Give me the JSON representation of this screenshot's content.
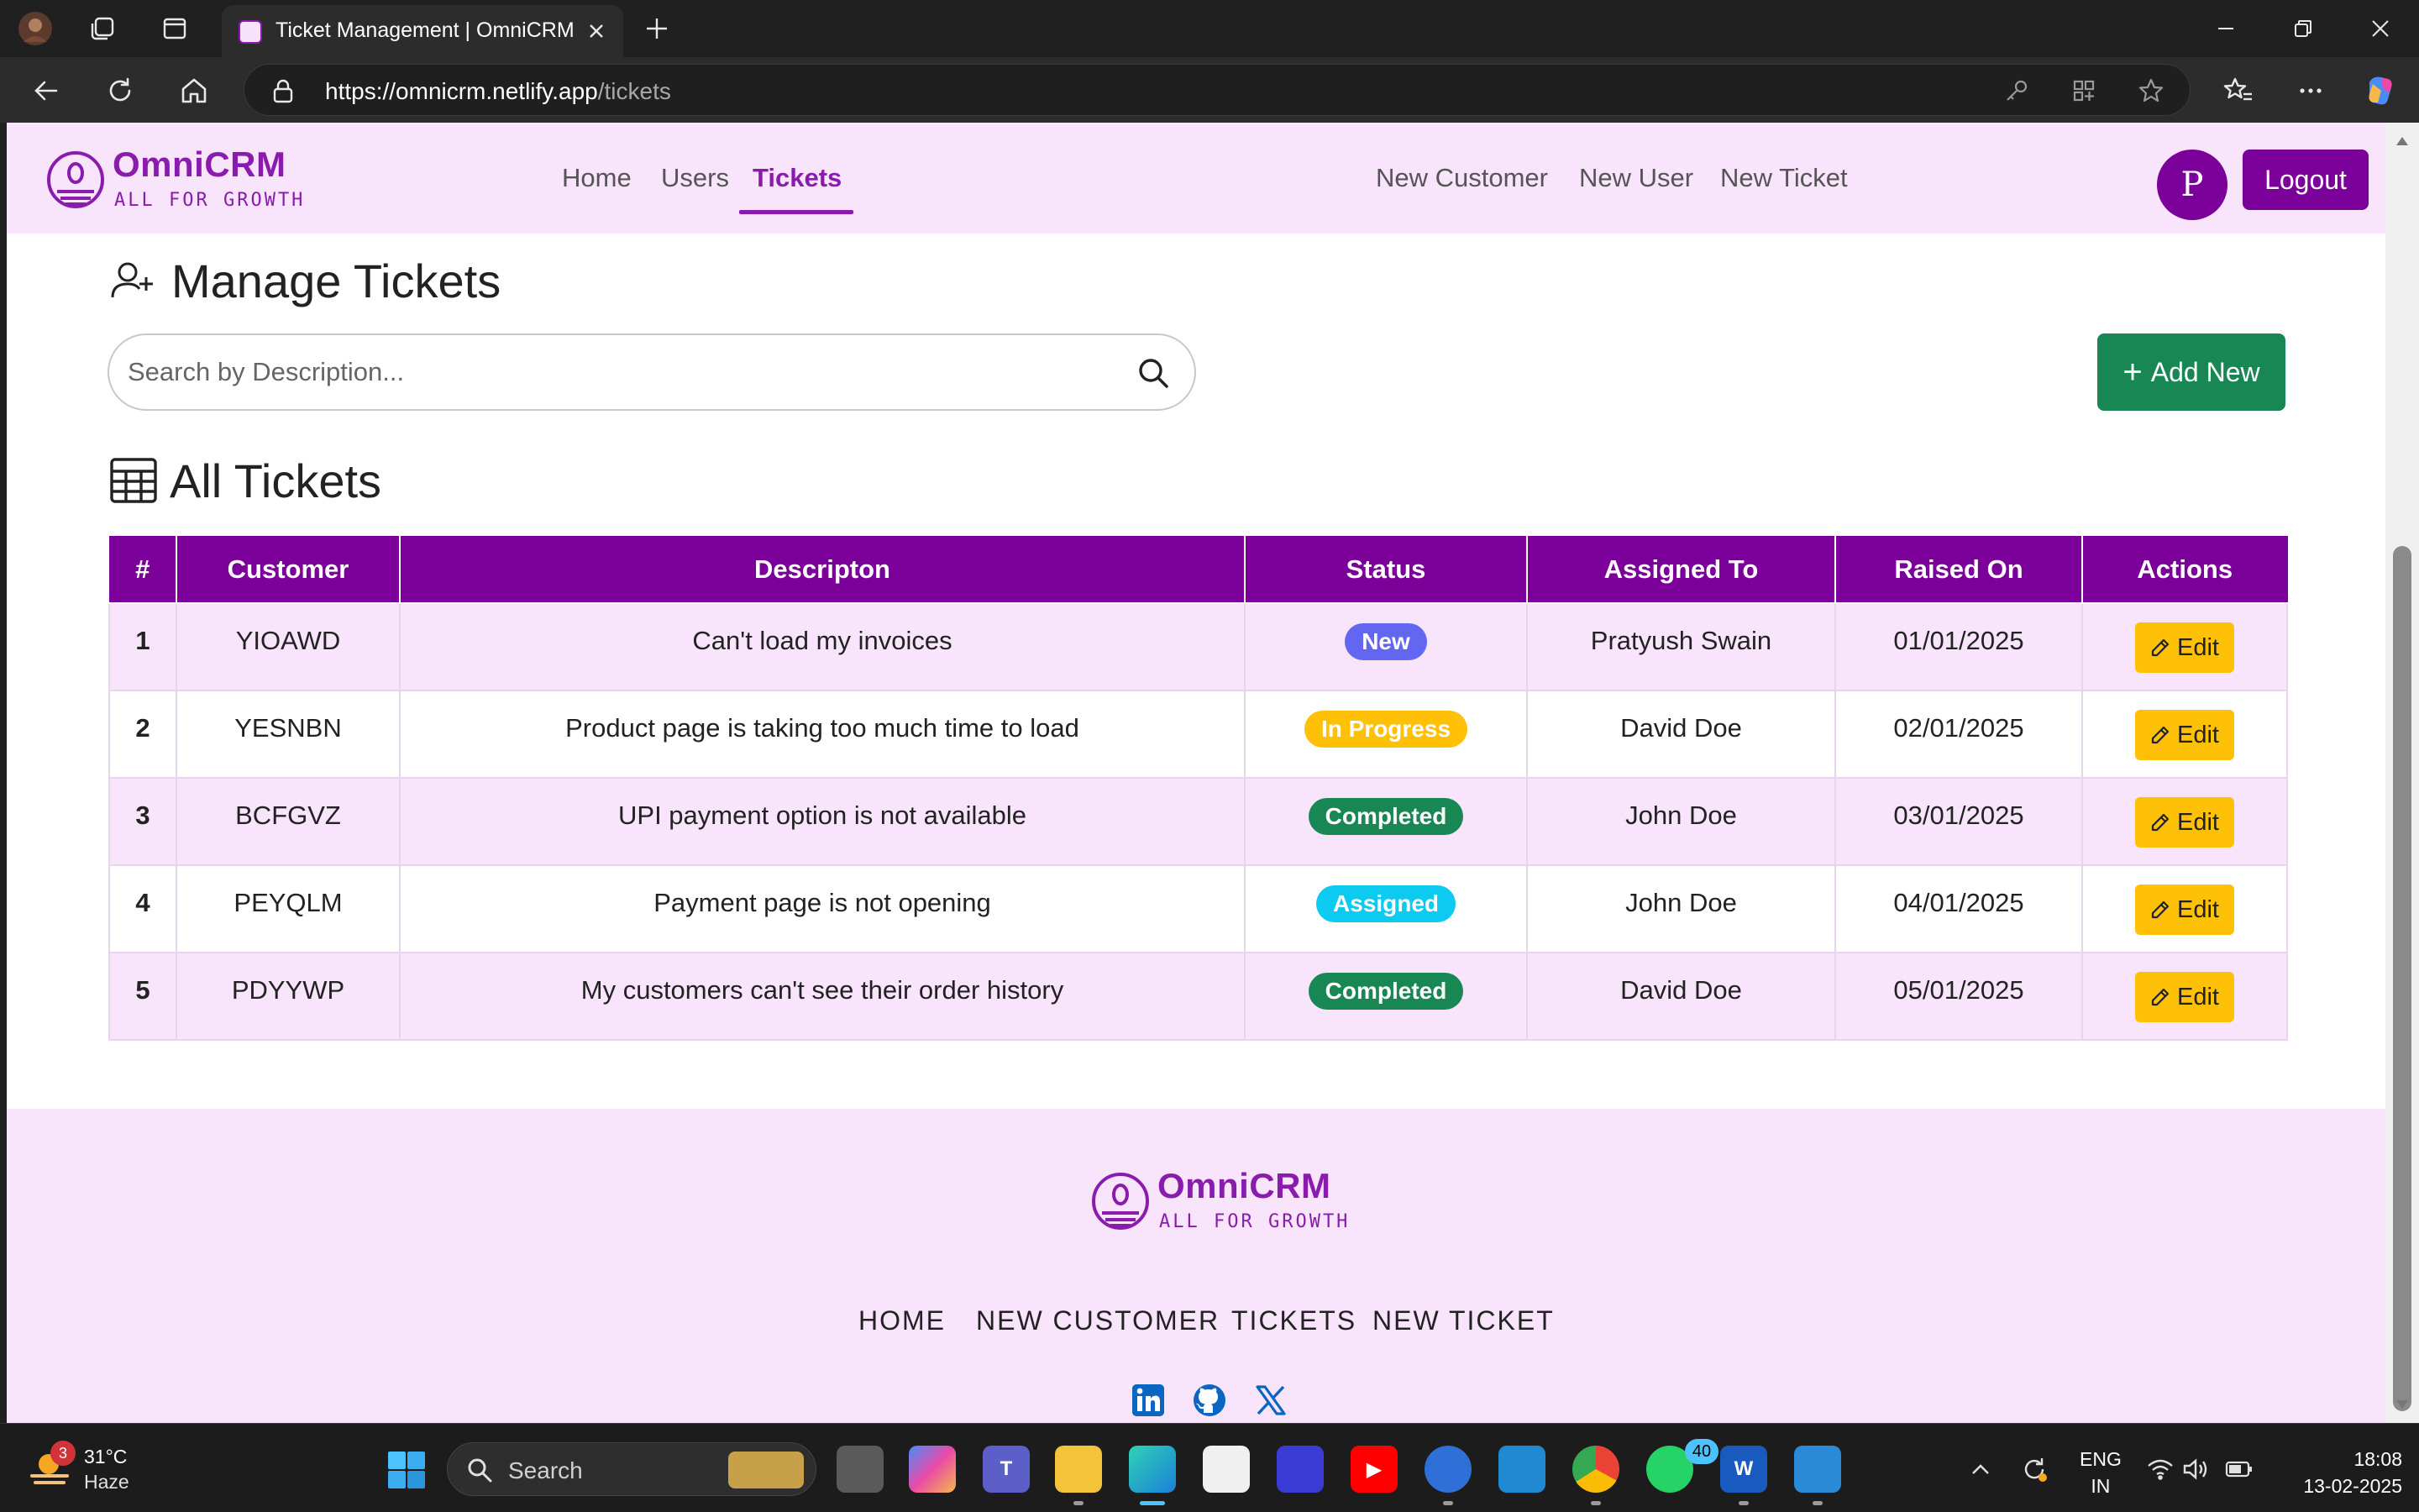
{
  "browser": {
    "tab_title": "Ticket Management | OmniCRM",
    "url_host": "https://omnicrm.netlify.app",
    "url_path": "/tickets"
  },
  "navbar": {
    "brand_name": "OmniCRM",
    "brand_tagline": "ALL FOR GROWTH",
    "links": [
      "Home",
      "Users",
      "Tickets"
    ],
    "active_link": "Tickets",
    "quick_links": [
      "New Customer",
      "New User",
      "New Ticket"
    ],
    "avatar_initial": "P",
    "logout_label": "Logout"
  },
  "main": {
    "page_title": "Manage Tickets",
    "search_placeholder": "Search by Description...",
    "add_new_label": "Add New",
    "table_title": "All Tickets",
    "columns": [
      "#",
      "Customer",
      "Descripton",
      "Status",
      "Assigned To",
      "Raised On",
      "Actions"
    ],
    "rows": [
      {
        "num": "1",
        "customer": "YIOAWD",
        "description": "Can't load my invoices",
        "status": "New",
        "assigned_to": "Pratyush Swain",
        "raised_on": "01/01/2025",
        "action": "Edit"
      },
      {
        "num": "2",
        "customer": "YESNBN",
        "description": "Product page is taking too much time to load",
        "status": "In Progress",
        "assigned_to": "David Doe",
        "raised_on": "02/01/2025",
        "action": "Edit"
      },
      {
        "num": "3",
        "customer": "BCFGVZ",
        "description": "UPI payment option is not available",
        "status": "Completed",
        "assigned_to": "John Doe",
        "raised_on": "03/01/2025",
        "action": "Edit"
      },
      {
        "num": "4",
        "customer": "PEYQLM",
        "description": "Payment page is not opening",
        "status": "Assigned",
        "assigned_to": "John Doe",
        "raised_on": "04/01/2025",
        "action": "Edit"
      },
      {
        "num": "5",
        "customer": "PDYYWP",
        "description": "My customers can't see their order history",
        "status": "Completed",
        "assigned_to": "David Doe",
        "raised_on": "05/01/2025",
        "action": "Edit"
      }
    ],
    "status_colors": {
      "New": "#6366f1",
      "In Progress": "#ffc107",
      "Completed": "#198754",
      "Assigned": "#0dcaf0"
    }
  },
  "footer": {
    "brand_name": "OmniCRM",
    "brand_tagline": "ALL FOR GROWTH",
    "links": [
      "HOME",
      "NEW CUSTOMER",
      "TICKETS",
      "NEW TICKET"
    ],
    "social_icons": [
      "linkedin-icon",
      "github-icon",
      "x-icon"
    ]
  },
  "taskbar": {
    "weather_temp": "31°C",
    "weather_desc": "Haze",
    "weather_badge": "3",
    "search_label": "Search",
    "whatsapp_badge": "40",
    "lang_line1": "ENG",
    "lang_line2": "IN",
    "time": "18:08",
    "date": "13-02-2025"
  },
  "colors": {
    "brand_purple": "#7a0099",
    "nav_bg": "#f8e4fb",
    "success_green": "#198754",
    "edit_yellow": "#ffc107"
  }
}
